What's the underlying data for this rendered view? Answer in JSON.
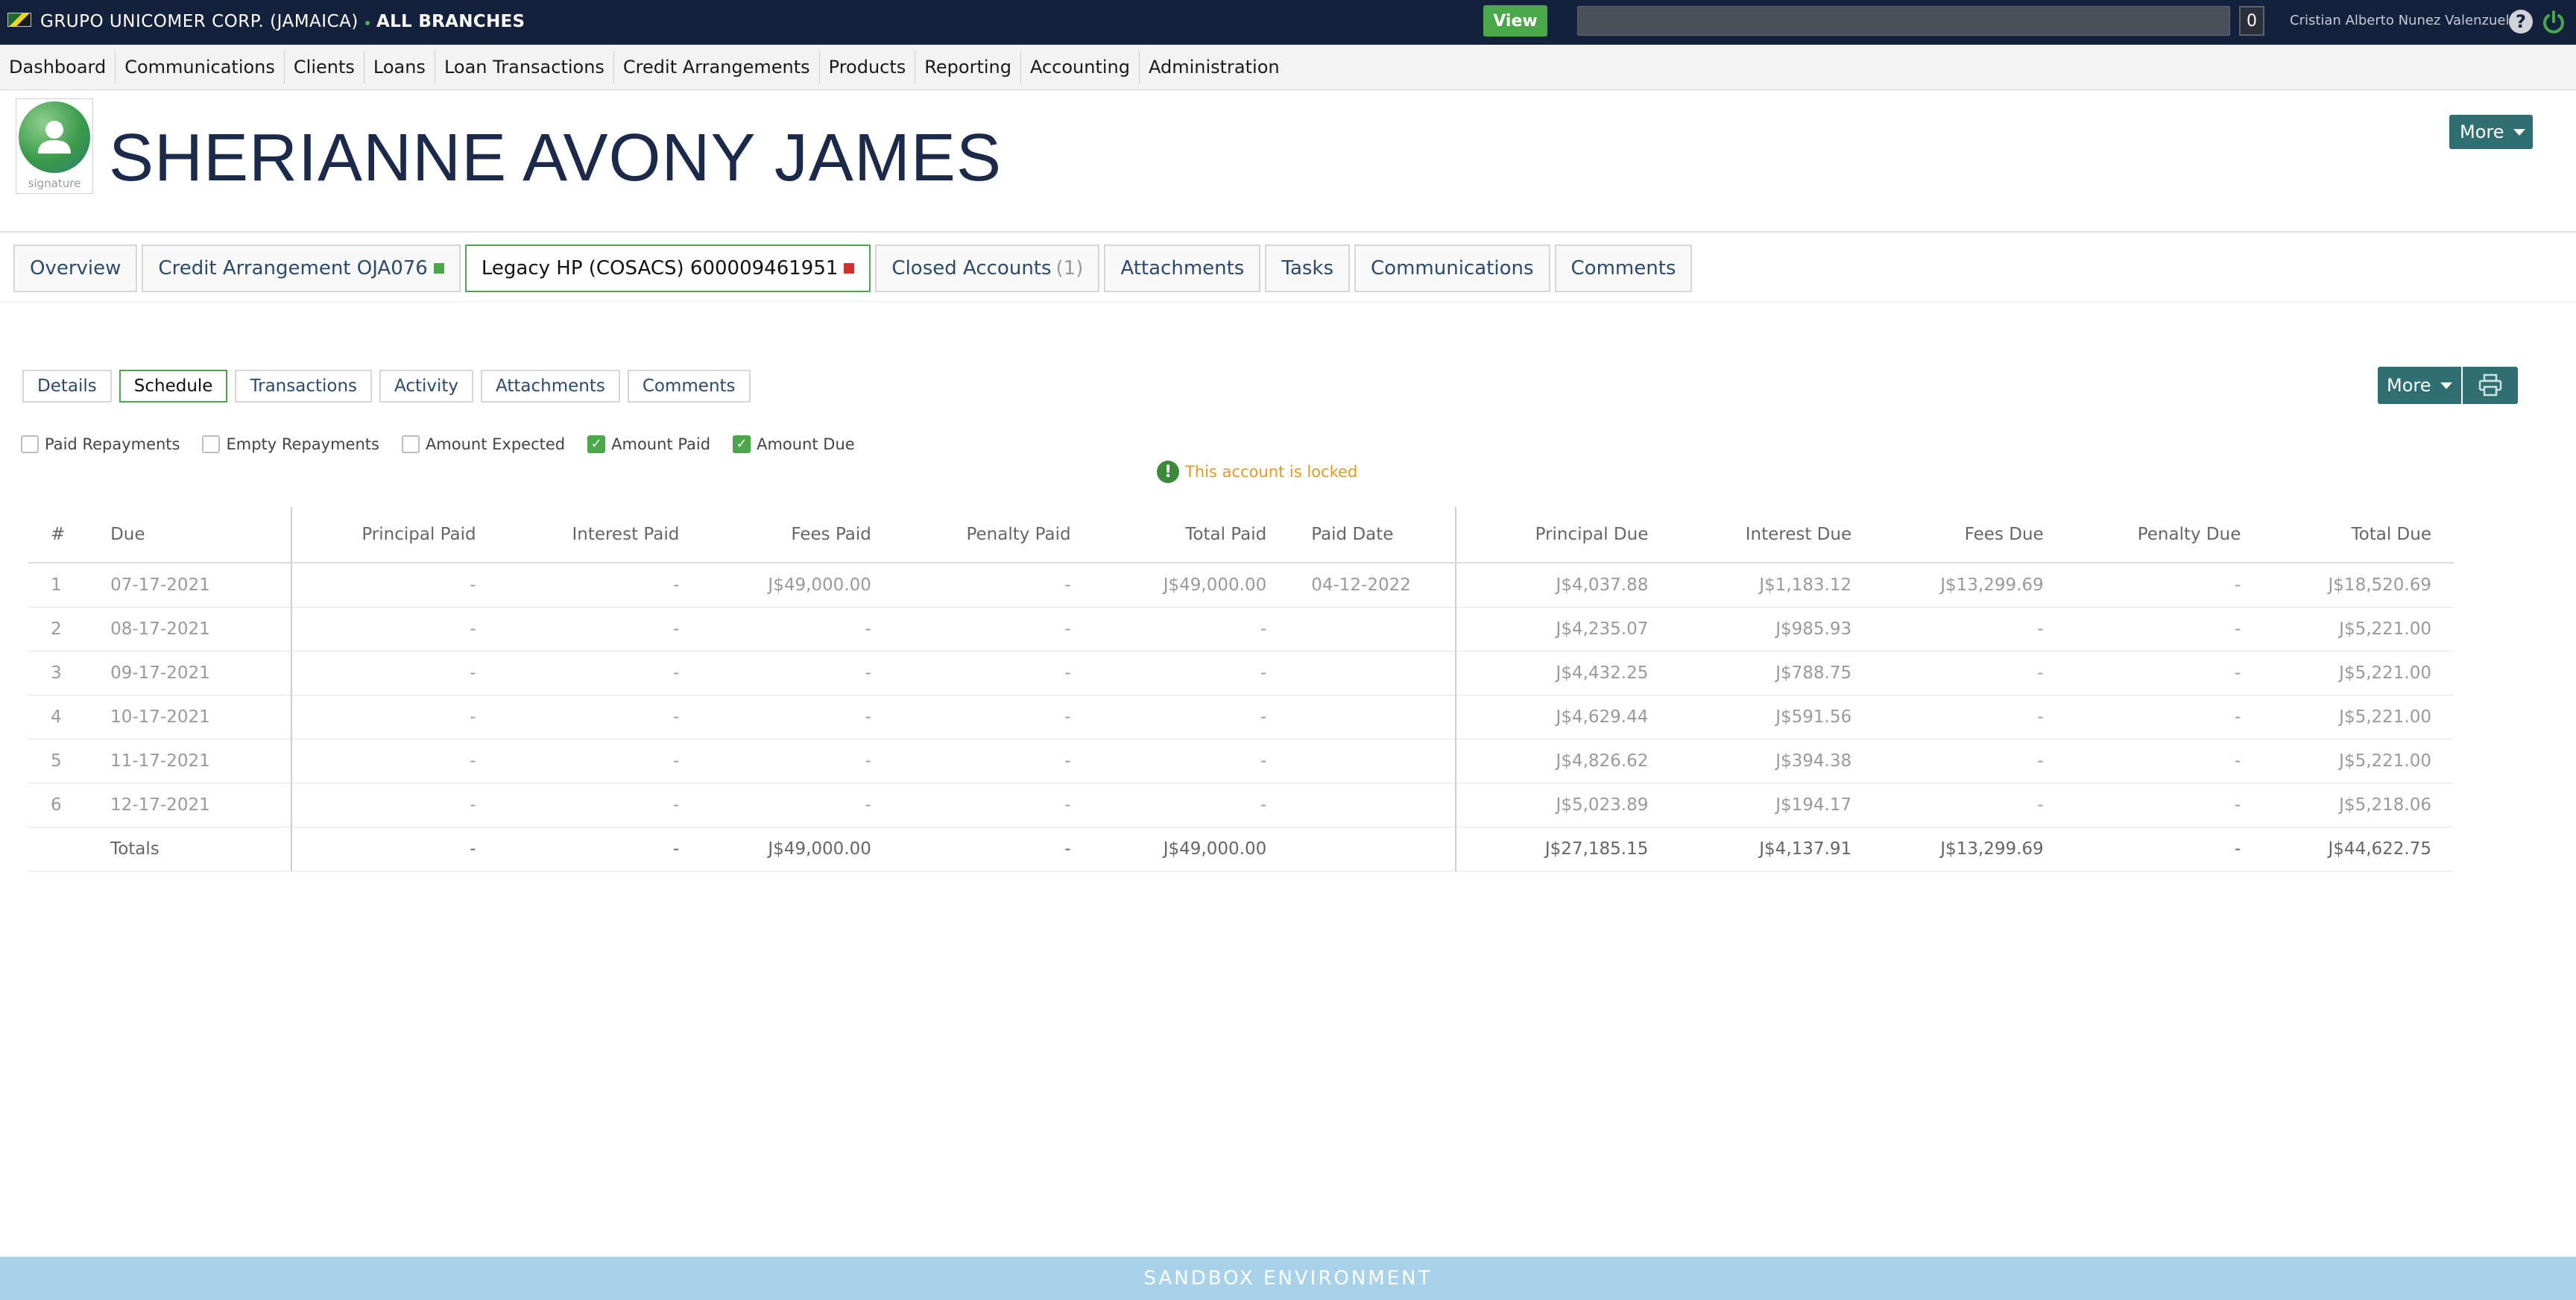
{
  "topbar": {
    "org_name": "GRUPO UNICOMER CORP. (JAMAICA)",
    "branch": "ALL BRANCHES",
    "view_label": "View",
    "search_value": "",
    "counter": "0",
    "user": "Cristian Alberto Nunez Valenzuela"
  },
  "nav": [
    "Dashboard",
    "Communications",
    "Clients",
    "Loans",
    "Loan Transactions",
    "Credit Arrangements",
    "Products",
    "Reporting",
    "Accounting",
    "Administration"
  ],
  "profile": {
    "name": "SHERIANNE AVONY JAMES",
    "signature_label": "signature",
    "more_label": "More"
  },
  "tabs": [
    {
      "label": "Overview"
    },
    {
      "label": "Credit Arrangement OJA076",
      "status_color": "#4aa84a"
    },
    {
      "label": "Legacy HP (COSACS) 600009461951",
      "status_color": "#d32f2f",
      "active": true
    },
    {
      "label": "Closed Accounts",
      "count": "(1)"
    },
    {
      "label": "Attachments"
    },
    {
      "label": "Tasks"
    },
    {
      "label": "Communications"
    },
    {
      "label": "Comments"
    }
  ],
  "subtabs": [
    "Details",
    "Schedule",
    "Transactions",
    "Activity",
    "Attachments",
    "Comments"
  ],
  "subtab_active": "Schedule",
  "actions": {
    "more_label": "More"
  },
  "filters": [
    {
      "label": "Paid Repayments",
      "checked": false
    },
    {
      "label": "Empty Repayments",
      "checked": false
    },
    {
      "label": "Amount Expected",
      "checked": false
    },
    {
      "label": "Amount Paid",
      "checked": true
    },
    {
      "label": "Amount Due",
      "checked": true
    }
  ],
  "lock_message": "This account is locked",
  "schedule": {
    "headers": [
      "#",
      "Due",
      "Principal Paid",
      "Interest Paid",
      "Fees Paid",
      "Penalty Paid",
      "Total Paid",
      "Paid Date",
      "Principal Due",
      "Interest Due",
      "Fees Due",
      "Penalty Due",
      "Total Due"
    ],
    "rows": [
      [
        "1",
        "07-17-2021",
        "-",
        "-",
        "J$49,000.00",
        "-",
        "J$49,000.00",
        "04-12-2022",
        "J$4,037.88",
        "J$1,183.12",
        "J$13,299.69",
        "-",
        "J$18,520.69"
      ],
      [
        "2",
        "08-17-2021",
        "-",
        "-",
        "-",
        "-",
        "-",
        "",
        "J$4,235.07",
        "J$985.93",
        "-",
        "-",
        "J$5,221.00"
      ],
      [
        "3",
        "09-17-2021",
        "-",
        "-",
        "-",
        "-",
        "-",
        "",
        "J$4,432.25",
        "J$788.75",
        "-",
        "-",
        "J$5,221.00"
      ],
      [
        "4",
        "10-17-2021",
        "-",
        "-",
        "-",
        "-",
        "-",
        "",
        "J$4,629.44",
        "J$591.56",
        "-",
        "-",
        "J$5,221.00"
      ],
      [
        "5",
        "11-17-2021",
        "-",
        "-",
        "-",
        "-",
        "-",
        "",
        "J$4,826.62",
        "J$394.38",
        "-",
        "-",
        "J$5,221.00"
      ],
      [
        "6",
        "12-17-2021",
        "-",
        "-",
        "-",
        "-",
        "-",
        "",
        "J$5,023.89",
        "J$194.17",
        "-",
        "-",
        "J$5,218.06"
      ]
    ],
    "totals": [
      "",
      "Totals",
      "-",
      "-",
      "J$49,000.00",
      "-",
      "J$49,000.00",
      "",
      "J$27,185.15",
      "J$4,137.91",
      "J$13,299.69",
      "-",
      "J$44,622.75"
    ]
  },
  "footer": "SANDBOX ENVIRONMENT"
}
